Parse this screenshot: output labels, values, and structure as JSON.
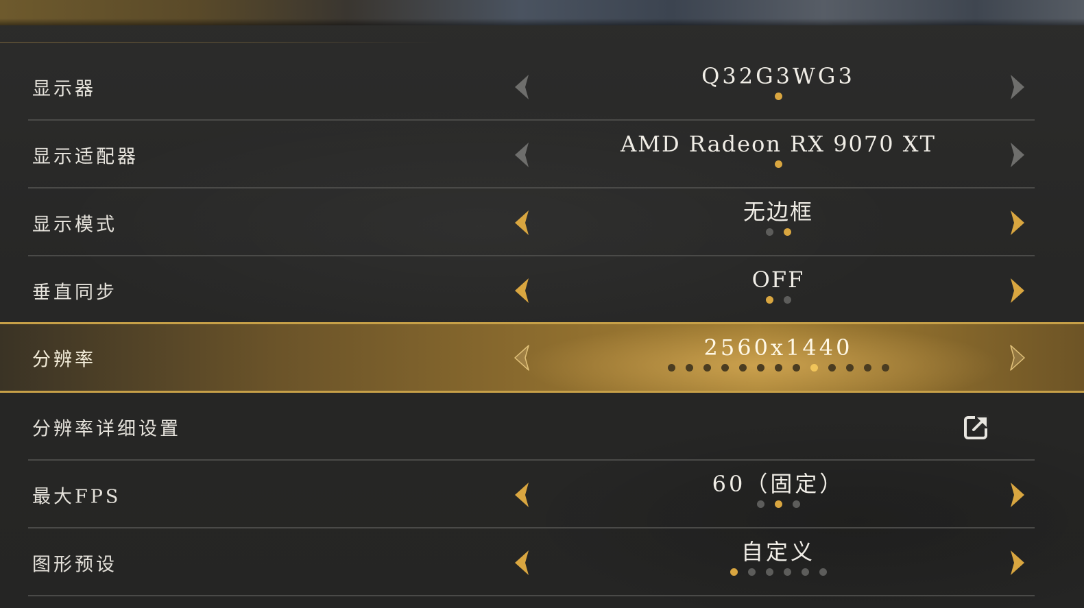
{
  "colors": {
    "accent_gold": "#d9a640",
    "arrow_inactive": "#6e6e6c",
    "dot_inactive": "#5d5d5b",
    "selected_bar": "#a17d33"
  },
  "settings": [
    {
      "label": "显示器",
      "value": "Q32G3WG3",
      "option_count": 1,
      "active_index": 0,
      "active_arrows": false,
      "icons": {
        "left": "chevron-left-icon",
        "right": "chevron-right-icon"
      }
    },
    {
      "label": "显示适配器",
      "value": "AMD Radeon RX 9070 XT",
      "option_count": 1,
      "active_index": 0,
      "active_arrows": false
    },
    {
      "label": "显示模式",
      "value": "无边框",
      "option_count": 2,
      "active_index": 1,
      "active_arrows": true
    },
    {
      "label": "垂直同步",
      "value": "OFF",
      "option_count": 2,
      "active_index": 0,
      "active_arrows": true
    },
    {
      "label": "分辨率",
      "value": "2560x1440",
      "option_count": 13,
      "active_index": 8,
      "active_arrows": true,
      "selected": true
    },
    {
      "label": "分辨率详细设置",
      "icon": "external-link-icon"
    },
    {
      "label": "最大FPS",
      "value": "60（固定）",
      "option_count": 3,
      "active_index": 1,
      "active_arrows": true
    },
    {
      "label": "图形预设",
      "value": "自定义",
      "option_count": 6,
      "active_index": 0,
      "active_arrows": true
    }
  ]
}
